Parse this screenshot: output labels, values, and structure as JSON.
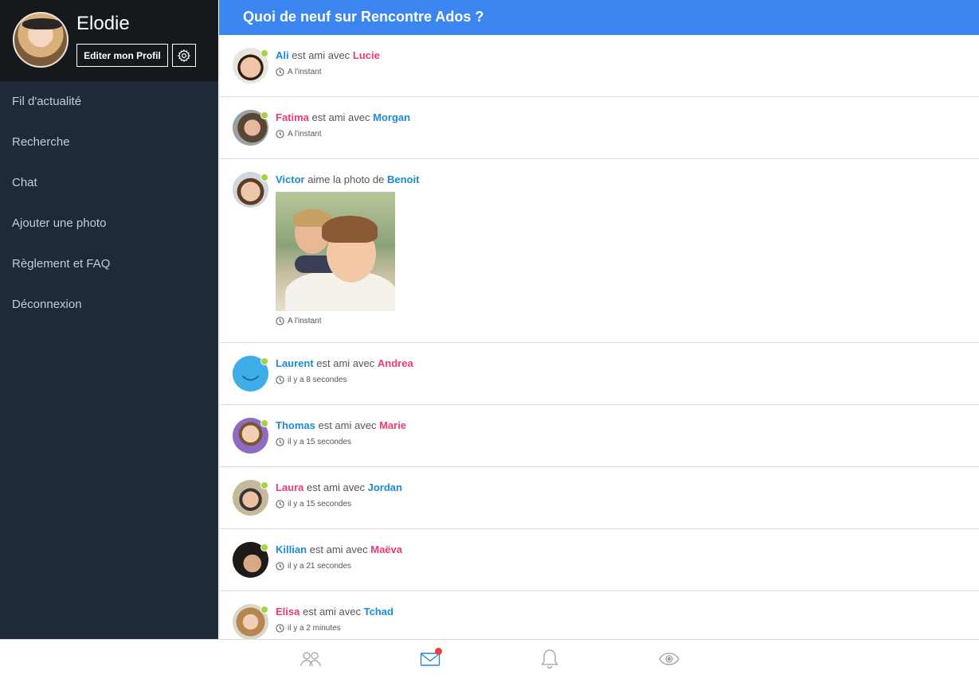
{
  "profile": {
    "name": "Elodie",
    "edit_label": "Editer mon Profil"
  },
  "nav": {
    "items": [
      {
        "label": "Fil d'actualité"
      },
      {
        "label": "Recherche"
      },
      {
        "label": "Chat"
      },
      {
        "label": "Ajouter une photo"
      },
      {
        "label": "Règlement et FAQ"
      },
      {
        "label": "Déconnexion"
      }
    ]
  },
  "header": {
    "title": "Quoi de neuf sur Rencontre Ados ?"
  },
  "feed": [
    {
      "actor": "Ali",
      "verb": "est ami avec",
      "target": "Lucie",
      "time": "A l'instant"
    },
    {
      "actor": "Fatima",
      "verb": "est ami avec",
      "target": "Morgan",
      "time": "A l'instant"
    },
    {
      "actor": "Victor",
      "verb": "aime la photo de",
      "target": "Benoit",
      "time": "A l'instant"
    },
    {
      "actor": "Laurent",
      "verb": "est ami avec",
      "target": "Andrea",
      "time": "il y a 8 secondes"
    },
    {
      "actor": "Thomas",
      "verb": "est ami avec",
      "target": "Marie",
      "time": "il y a 15 secondes"
    },
    {
      "actor": "Laura",
      "verb": "est ami avec",
      "target": "Jordan",
      "time": "il y a 15 secondes"
    },
    {
      "actor": "Killian",
      "verb": "est ami avec",
      "target": "Maëva",
      "time": "il y a 21 secondes"
    },
    {
      "actor": "Elisa",
      "verb": "est ami avec",
      "target": "Tchad",
      "time": "il y a 2 minutes"
    }
  ],
  "colors": {
    "accent": "#3b86f0",
    "sidebar": "#1e2a38",
    "male_name": "#1c8ad4",
    "female_name": "#ec3b6e",
    "online": "#a2d246",
    "badge": "#f23d3d"
  },
  "bottom_tabs": [
    {
      "icon": "friends-icon"
    },
    {
      "icon": "mail-icon"
    },
    {
      "icon": "bell-icon"
    },
    {
      "icon": "eye-icon"
    }
  ]
}
